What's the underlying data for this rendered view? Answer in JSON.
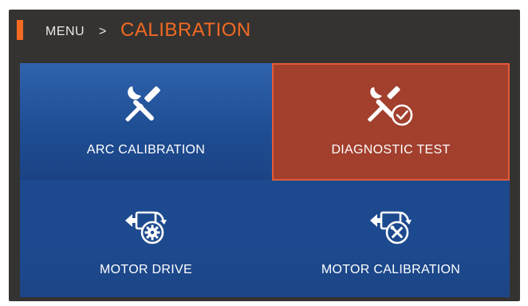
{
  "header": {
    "breadcrumb_root": "MENU",
    "breadcrumb_sep": ">",
    "current_page": "CALIBRATION"
  },
  "tiles": [
    {
      "label": "ARC CALIBRATION",
      "icon": "tools-icon",
      "state": "normal"
    },
    {
      "label": "DIAGNOSTIC TEST",
      "icon": "tools-check-icon",
      "state": "selected"
    },
    {
      "label": "MOTOR DRIVE",
      "icon": "motor-gear-icon",
      "state": "normal"
    },
    {
      "label": "MOTOR CALIBRATION",
      "icon": "motor-tools-icon",
      "state": "normal"
    }
  ],
  "colors": {
    "accent": "#f26a22",
    "background": "#353331",
    "tile_blue": "#1f4e94",
    "tile_selected": "#a23f2d",
    "tile_selected_border": "#e25a37"
  }
}
